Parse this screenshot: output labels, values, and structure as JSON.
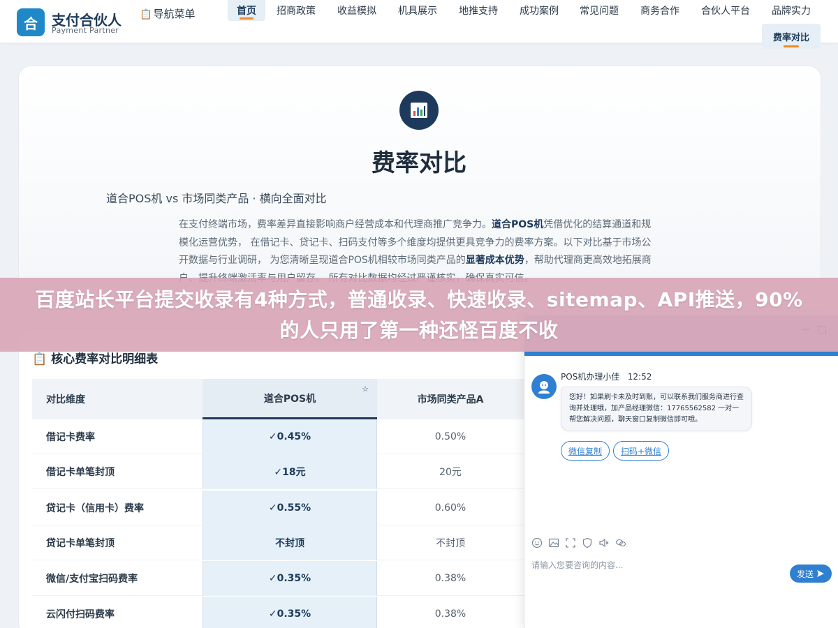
{
  "brand": {
    "logo_char": "合",
    "name": "支付合伙人",
    "tagline": "Payment Partner"
  },
  "nav_menu": {
    "icon": "clipboard-icon",
    "label": "导航菜单"
  },
  "nav": {
    "items": [
      "首页",
      "招商政策",
      "收益模拟",
      "机具展示",
      "地推支持",
      "成功案例",
      "常见问题",
      "商务合作",
      "合伙人平台",
      "品牌实力"
    ],
    "active": "首页",
    "second_row": "费率对比"
  },
  "hero": {
    "icon": "chart-icon",
    "title": "费率对比",
    "subtitle": "道合POS机 vs 市场同类产品 · 横向全面对比",
    "desc_1": "在支付终端市场，费率差异直接影响商户经营成本和代理商推广竞争力。",
    "desc_brand": "道合POS机",
    "desc_2": "凭借优化的结算通道和规模化运营优势， 在借记卡、贷记卡、扫码支付等多个维度均提供更具竞争力的费率方案。以下对比基于市场公开数据与行业调研， 为您清晰呈现道合POS机相较市场同类产品的",
    "desc_highlight": "显著成本优势",
    "desc_3": "，帮助代理商更高效地拓展商户、提升终端激活率与用户留存。 所有对比数据均经过严谨核实，确保真实可信。"
  },
  "table": {
    "title": "核心费率对比明细表",
    "title_icon": "clipboard-icon",
    "headers": [
      "对比维度",
      "道合POS机",
      "市场同类产品A"
    ],
    "rows": [
      {
        "label": "借记卡费率",
        "ours": "✓0.45%",
        "other": "0.50%"
      },
      {
        "label": "借记卡单笔封顶",
        "ours": "✓18元",
        "other": "20元"
      },
      {
        "label": "贷记卡（信用卡）费率",
        "ours": "✓0.55%",
        "other": "0.60%"
      },
      {
        "label": "贷记卡单笔封顶",
        "ours": "不封顶",
        "other": "不封顶"
      },
      {
        "label": "微信/支付宝扫码费率",
        "ours": "✓0.35%",
        "other": "0.38%"
      },
      {
        "label": "云闪付扫码费率",
        "ours": "✓0.35%",
        "other": "0.38%"
      }
    ]
  },
  "chat": {
    "agent_name": "POS机办理小佳",
    "time": "12:52",
    "message": "您好！如果刷卡未及时到账，可以联系我们服务商进行查询并处理哦，加产品经理微信：17765562582 一对一帮您解决问题，聊天窗口复制微信即可哦。",
    "buttons": [
      "微信复制",
      "扫码+微信"
    ],
    "input_placeholder": "请输入您要咨询的内容...",
    "send_label": "发送",
    "minimize_glyph": "—",
    "maximize_glyph": "□"
  },
  "banner": {
    "text": "百度站长平台提交收录有4种方式，普通收录、快速收录、sitemap、API推送，90%的人只用了第一种还怪百度不收"
  },
  "colors": {
    "brand_blue": "#1e88c8",
    "navy": "#1d3a5c",
    "accent_orange": "#f08a24",
    "chat_blue": "#2f80d0",
    "banner_pink": "#d6a0b2"
  }
}
